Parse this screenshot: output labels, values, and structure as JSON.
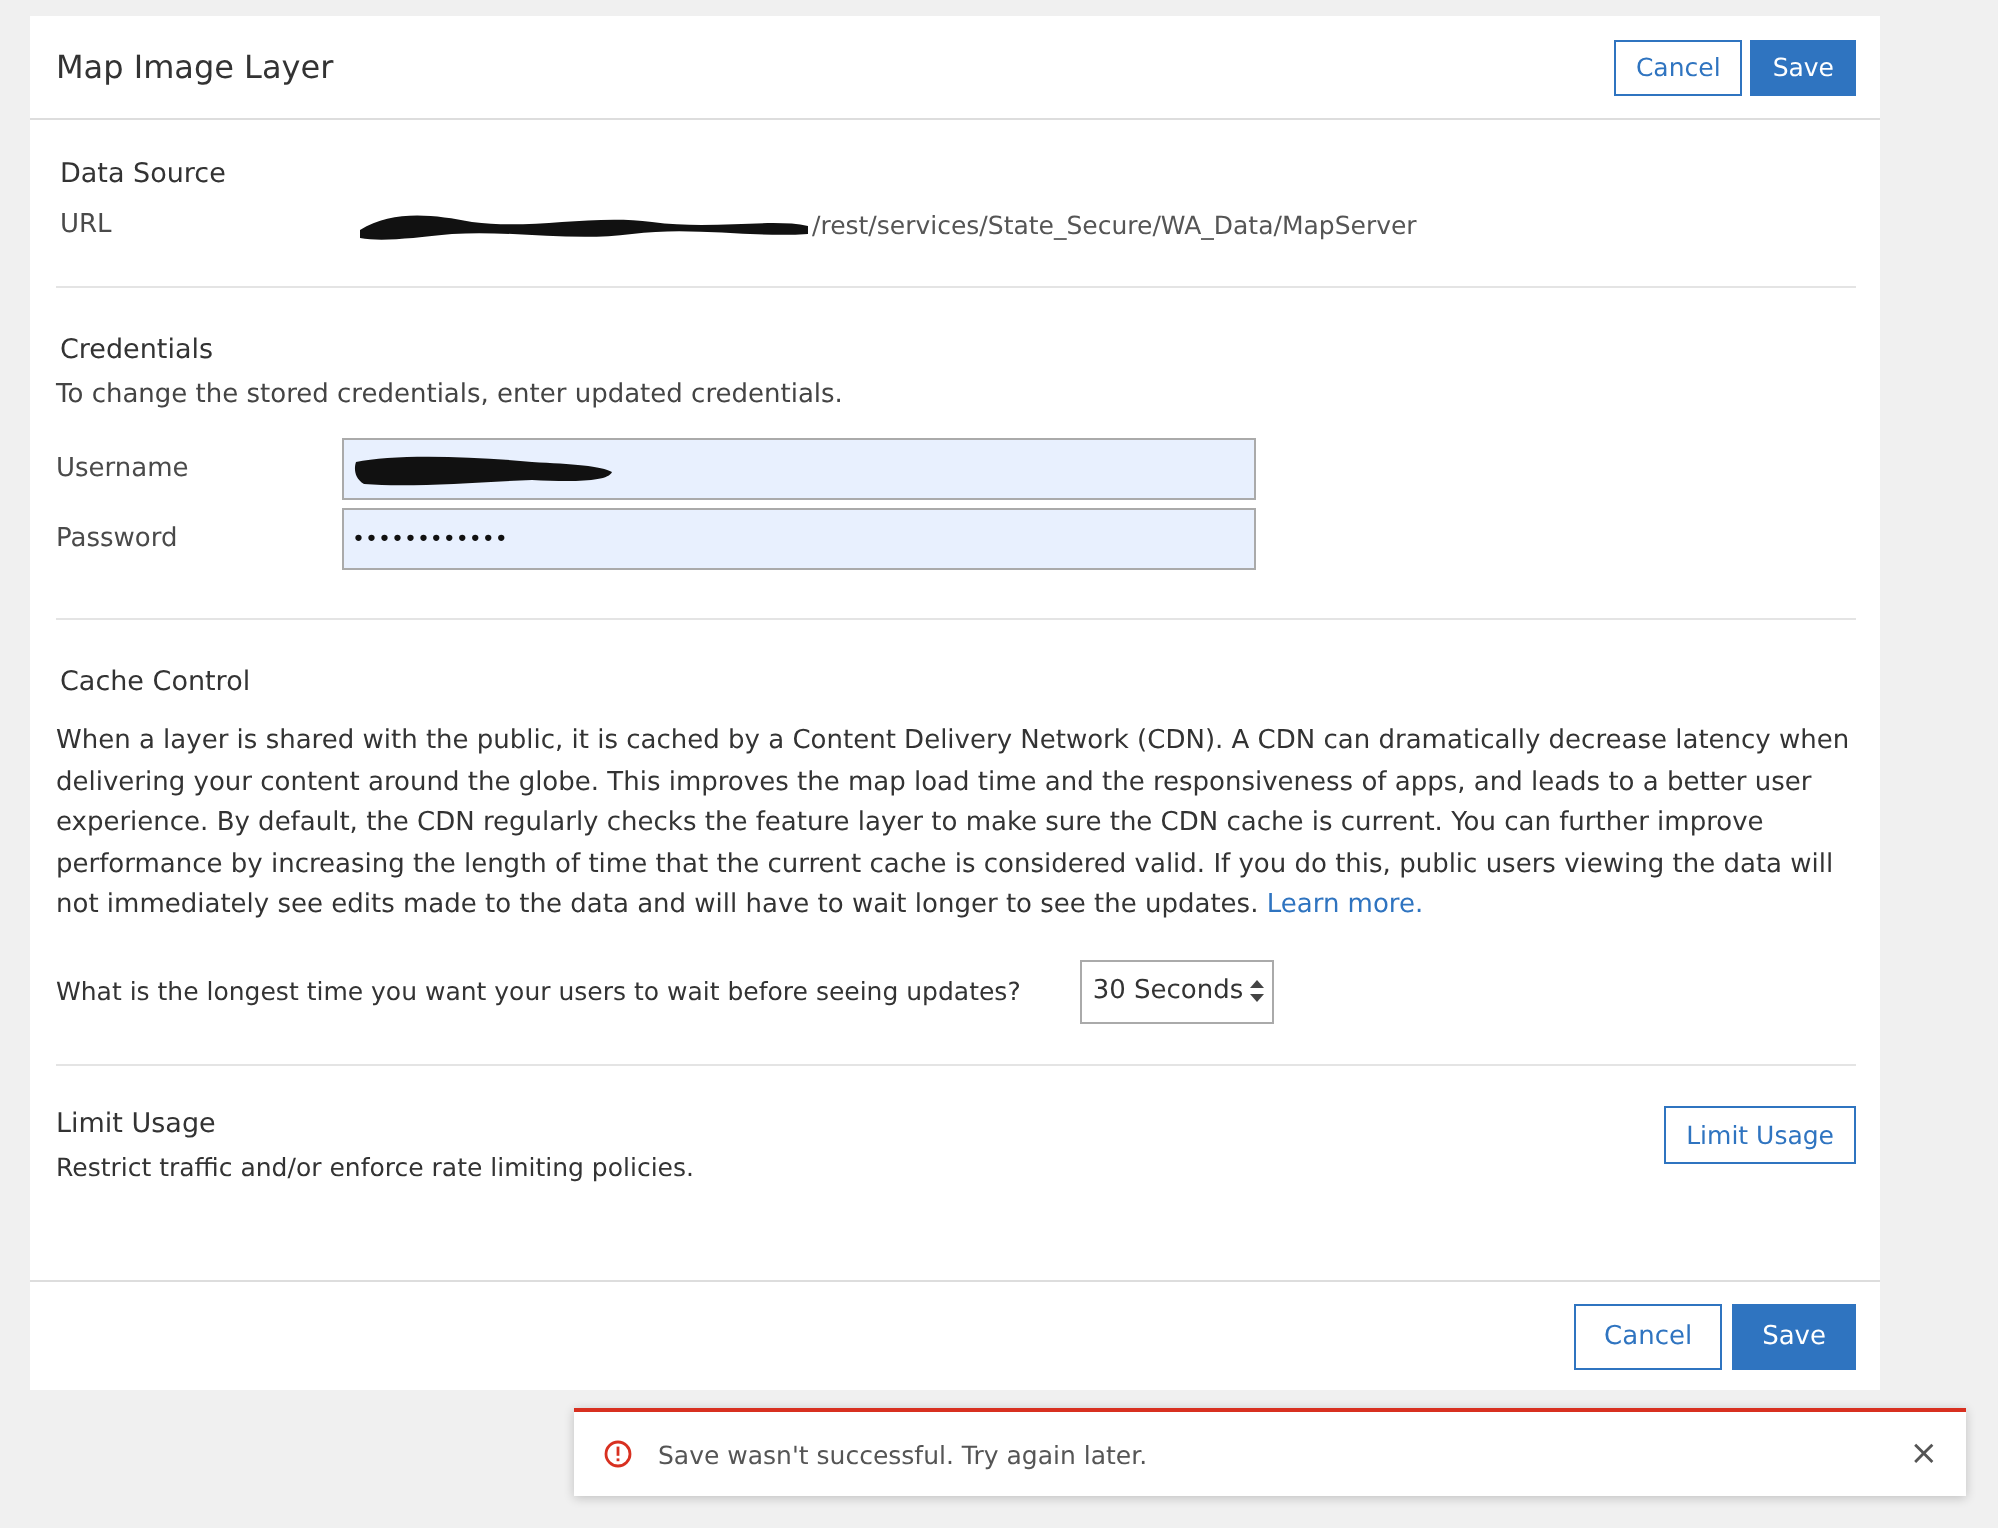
{
  "header": {
    "title": "Map Image Layer",
    "buttons": [
      {
        "label": "Cancel",
        "kind": "secondary"
      },
      {
        "label": "Save",
        "kind": "primary"
      }
    ]
  },
  "data_source": {
    "heading": "Data Source",
    "url_label": "URL",
    "url_value": "/rest/services/State_Secure/WA_Data/MapServer"
  },
  "credentials": {
    "heading": "Credentials",
    "description": "To change the stored credentials, enter updated credentials.",
    "username_label": "Username",
    "password_label": "Password",
    "password_value": "••••••••••••"
  },
  "cache_control": {
    "heading": "Cache Control",
    "paragraph": "When a layer is shared with the public, it is cached by a Content Delivery Network (CDN). A CDN can dramatically decrease latency when delivering your content around the globe. This improves the map load time and the responsiveness of apps, and leads to a better user experience. By default, the CDN regularly checks the feature layer to make sure the CDN cache is current. You can further improve performance by increasing the length of time that the current cache is considered valid. If you do this, public users viewing the data will not immediately see edits made to the data and will have to wait longer to see the updates.",
    "link": "Learn more.",
    "question": "What is the longest time you want your users to wait before seeing updates?",
    "select_value": "30 Seconds"
  },
  "limit_usage": {
    "heading": "Limit Usage",
    "description": "Restrict traffic and/or enforce rate limiting policies.",
    "button": "Limit Usage"
  },
  "footer": {
    "buttons": [
      {
        "label": "Cancel",
        "kind": "secondary"
      },
      {
        "label": "Save",
        "kind": "primary"
      }
    ]
  },
  "toast": {
    "message": "Save wasn't successful. Try again later.",
    "close": "×"
  }
}
